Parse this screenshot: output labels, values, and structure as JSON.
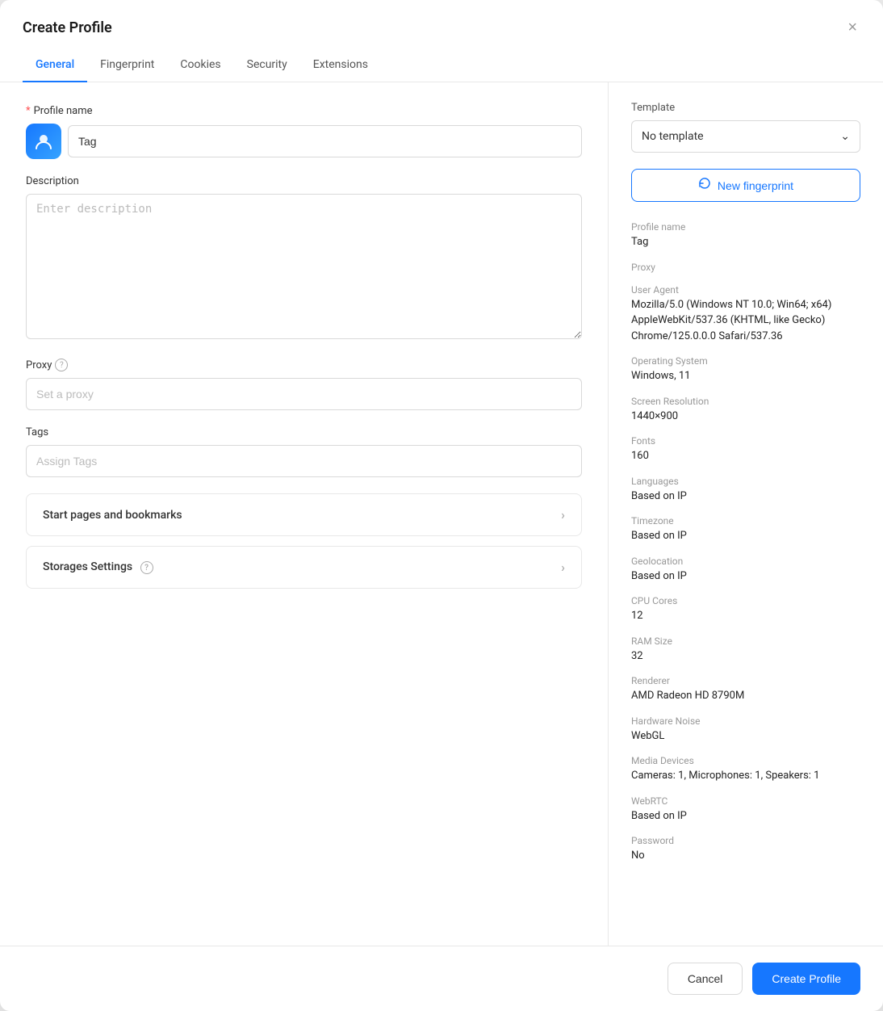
{
  "modal": {
    "title": "Create Profile",
    "close_label": "×"
  },
  "tabs": {
    "items": [
      {
        "id": "general",
        "label": "General",
        "active": true
      },
      {
        "id": "fingerprint",
        "label": "Fingerprint",
        "active": false
      },
      {
        "id": "cookies",
        "label": "Cookies",
        "active": false
      },
      {
        "id": "security",
        "label": "Security",
        "active": false
      },
      {
        "id": "extensions",
        "label": "Extensions",
        "active": false
      }
    ]
  },
  "form": {
    "profile_name_label": "Profile name",
    "profile_name_value": "Tag",
    "description_label": "Description",
    "description_placeholder": "Enter description",
    "proxy_label": "Proxy",
    "proxy_placeholder": "Set a proxy",
    "tags_label": "Tags",
    "tags_placeholder": "Assign Tags",
    "start_pages_label": "Start pages and bookmarks",
    "storages_label": "Storages Settings"
  },
  "right_panel": {
    "template_label": "Template",
    "template_value": "No template",
    "new_fingerprint_label": "New fingerprint",
    "fingerprint_icon": "⇄",
    "profile_info": {
      "profile_name_label": "Profile name",
      "profile_name_value": "Tag",
      "proxy_label": "Proxy",
      "proxy_value": "",
      "user_agent_label": "User Agent",
      "user_agent_value": "Mozilla/5.0 (Windows NT 10.0; Win64; x64) AppleWebKit/537.36 (KHTML, like Gecko) Chrome/125.0.0.0 Safari/537.36",
      "os_label": "Operating System",
      "os_value": "Windows, 11",
      "screen_label": "Screen Resolution",
      "screen_value": "1440×900",
      "fonts_label": "Fonts",
      "fonts_value": "160",
      "languages_label": "Languages",
      "languages_value": "Based on IP",
      "timezone_label": "Timezone",
      "timezone_value": "Based on IP",
      "geolocation_label": "Geolocation",
      "geolocation_value": "Based on IP",
      "cpu_label": "CPU Cores",
      "cpu_value": "12",
      "ram_label": "RAM Size",
      "ram_value": "32",
      "renderer_label": "Renderer",
      "renderer_value": "AMD Radeon HD 8790M",
      "hardware_noise_label": "Hardware Noise",
      "hardware_noise_value": "WebGL",
      "media_devices_label": "Media Devices",
      "media_devices_value": "Cameras: 1, Microphones: 1, Speakers: 1",
      "webrtc_label": "WebRTC",
      "webrtc_value": "Based on IP",
      "password_label": "Password",
      "password_value": "No"
    }
  },
  "footer": {
    "cancel_label": "Cancel",
    "create_label": "Create Profile"
  }
}
